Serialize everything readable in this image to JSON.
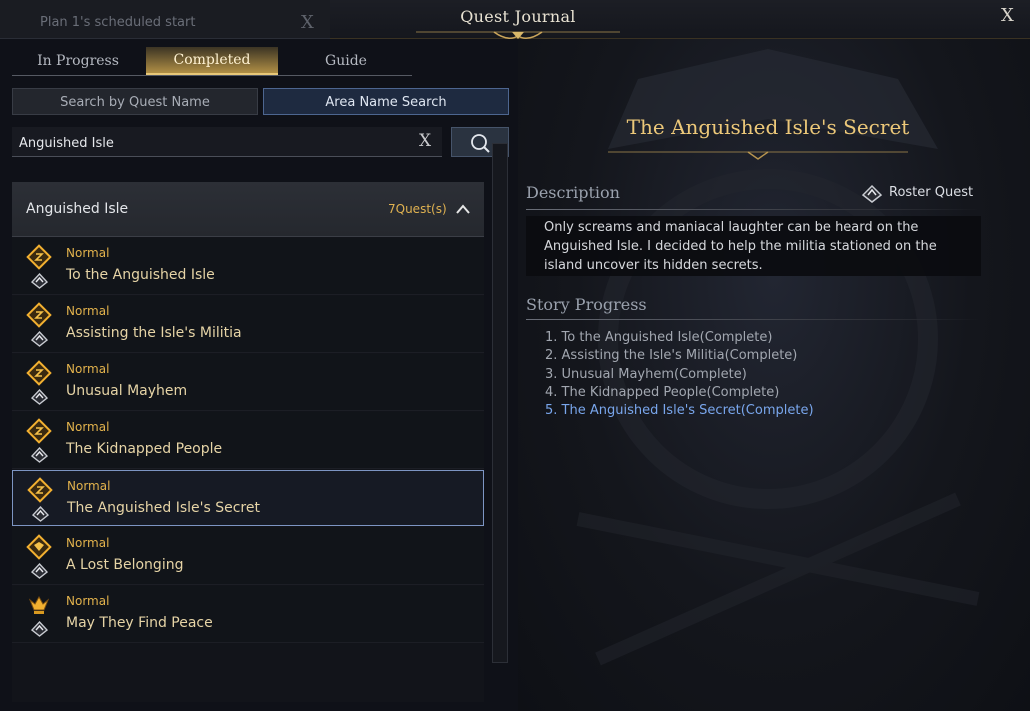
{
  "background_notice": {
    "text": "Plan 1's scheduled start",
    "close_glyph": "X"
  },
  "window": {
    "title": "Quest Journal",
    "close_glyph": "X"
  },
  "tabs": [
    {
      "label": "In Progress",
      "active": false
    },
    {
      "label": "Completed",
      "active": true
    },
    {
      "label": "Guide",
      "active": false
    }
  ],
  "search_modes": [
    {
      "label": "Search by Quest Name",
      "active": false
    },
    {
      "label": "Area Name Search",
      "active": true
    }
  ],
  "search": {
    "value": "Anguished Isle",
    "clear_glyph": "X",
    "button_icon": "search-icon"
  },
  "area_group": {
    "name": "Anguished Isle",
    "count": "7Quest(s)",
    "expanded": true
  },
  "quests": [
    {
      "category": "Normal",
      "name": "To the Anguished Isle",
      "icon": "quest-emblem-icon",
      "selected": false
    },
    {
      "category": "Normal",
      "name": "Assisting the Isle's Militia",
      "icon": "quest-emblem-icon",
      "selected": false
    },
    {
      "category": "Normal",
      "name": "Unusual Mayhem",
      "icon": "quest-emblem-icon",
      "selected": false
    },
    {
      "category": "Normal",
      "name": "The Kidnapped People",
      "icon": "quest-emblem-icon",
      "selected": false
    },
    {
      "category": "Normal",
      "name": "The Anguished Isle's Secret",
      "icon": "quest-emblem-icon",
      "selected": true
    },
    {
      "category": "Normal",
      "name": "A Lost Belonging",
      "icon": "quest-diamond-icon",
      "selected": false
    },
    {
      "category": "Normal",
      "name": "May They Find Peace",
      "icon": "quest-crown-icon",
      "selected": false
    }
  ],
  "detail": {
    "title": "The Anguished Isle's Secret",
    "description_label": "Description",
    "roster_label": "Roster Quest",
    "description": "Only screams and maniacal laughter can be heard on the Anguished Isle. I decided to help the militia stationed on the island uncover its hidden secrets.",
    "story_label": "Story Progress",
    "story_steps": [
      "1. To the Anguished Isle(Complete)",
      "2. Assisting the Isle's Militia(Complete)",
      "3. Unusual Mayhem(Complete)",
      "4. The Kidnapped People(Complete)",
      "5. The Anguished Isle's Secret(Complete)"
    ],
    "current_step_index": 4
  },
  "colors": {
    "accent_gold": "#e2b24c",
    "title_gold": "#ecc879",
    "current_step_blue": "#79a6ec",
    "selection_border": "#7d95c3"
  }
}
